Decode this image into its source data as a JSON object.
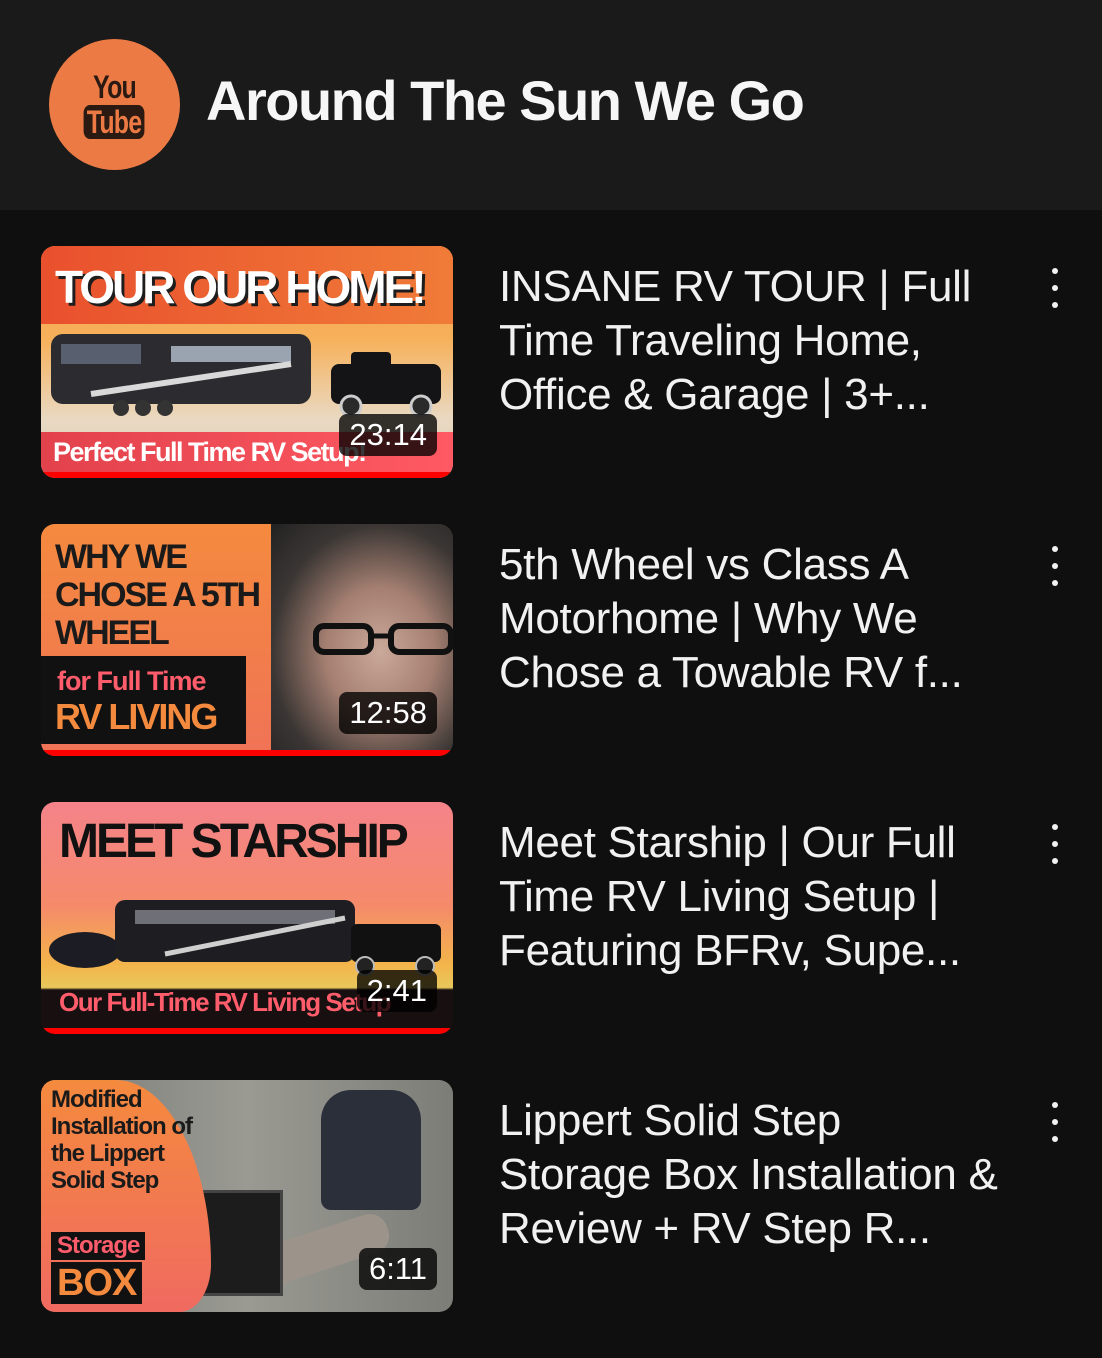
{
  "header": {
    "avatar_logo_top": "You",
    "avatar_logo_bottom": "Tube",
    "channel_name": "Around The Sun We Go"
  },
  "videos": [
    {
      "title": "INSANE RV TOUR | Full Time Traveling Home, Office & Garage | 3+...",
      "duration": "23:14",
      "thumb_headline": "TOUR OUR HOME!",
      "thumb_caption": "Perfect Full Time RV Setup!"
    },
    {
      "title": "5th Wheel vs Class A Motorhome | Why We Chose a Towable RV f...",
      "duration": "12:58",
      "thumb_headline": "WHY WE CHOSE A 5TH WHEEL",
      "thumb_caption_1": "for Full Time",
      "thumb_caption_2": "RV LIVING"
    },
    {
      "title": "Meet Starship | Our Full Time RV Living Setup | Featuring BFRv, Supe...",
      "duration": "2:41",
      "thumb_headline": "MEET STARSHIP",
      "thumb_caption": "Our Full-Time RV Living Setup"
    },
    {
      "title": "Lippert Solid Step Storage Box Installation & Review + RV Step R...",
      "duration": "6:11",
      "thumb_headline": "Modified Installation of the Lippert Solid Step",
      "thumb_caption_1": "Storage",
      "thumb_caption_2": "BOX"
    }
  ],
  "colors": {
    "background": "#0f0f0f",
    "header_background": "#1a1a1a",
    "avatar": "#ec7a45",
    "progress_red": "#ff0000"
  },
  "icons": {
    "more_options": "vertical-ellipsis-icon"
  }
}
